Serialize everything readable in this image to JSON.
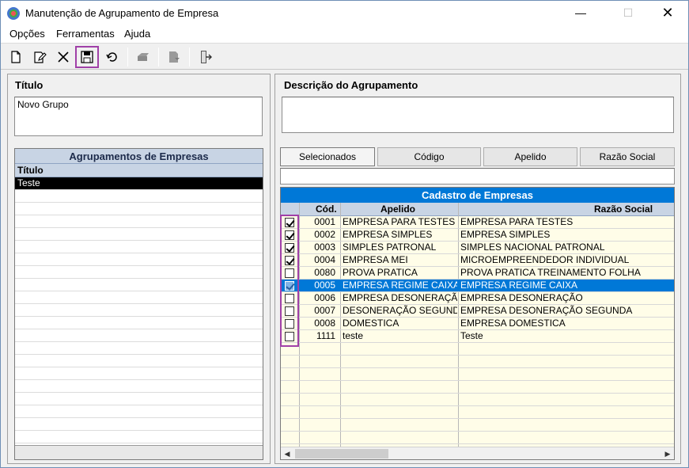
{
  "window": {
    "title": "Manutenção de Agrupamento de Empresa",
    "min": "—",
    "max": "☐",
    "close": "✕"
  },
  "menu": [
    "Opções",
    "Ferramentas",
    "Ajuda"
  ],
  "toolbar": {
    "buttons": [
      "new-document-icon",
      "edit-icon",
      "delete-icon",
      "save-icon",
      "undo-icon",
      "print-icon",
      "export-icon",
      "exit-icon"
    ],
    "highlight_color": "#a040a8"
  },
  "left": {
    "titulo_label": "Título",
    "titulo_value": "Novo Grupo",
    "grid_caption": "Agrupamentos de Empresas",
    "grid_header": "Título",
    "rows": [
      "Teste"
    ]
  },
  "right": {
    "descricao_label": "Descrição do Agrupamento",
    "descricao_value": "",
    "sort_buttons": [
      "Selecionados",
      "Código",
      "Apelido",
      "Razão Social"
    ],
    "search_value": "",
    "grid_caption": "Cadastro de Empresas",
    "columns": [
      "Cód.",
      "Apelido",
      "Razão Social"
    ],
    "rows": [
      {
        "checked": true,
        "cod": "0001",
        "apelido": "EMPRESA PARA TESTES",
        "razao": "EMPRESA PARA TESTES"
      },
      {
        "checked": true,
        "cod": "0002",
        "apelido": "EMPRESA SIMPLES",
        "razao": "EMPRESA SIMPLES"
      },
      {
        "checked": true,
        "cod": "0003",
        "apelido": "SIMPLES PATRONAL",
        "razao": "SIMPLES NACIONAL PATRONAL"
      },
      {
        "checked": true,
        "cod": "0004",
        "apelido": "EMPRESA MEI",
        "razao": "MICROEMPREENDEDOR INDIVIDUAL"
      },
      {
        "checked": false,
        "cod": "0080",
        "apelido": "PROVA PRATICA",
        "razao": "PROVA PRATICA TREINAMENTO FOLHA"
      },
      {
        "checked": true,
        "cod": "0005",
        "apelido": "EMPRESA REGIME CAIXA",
        "razao": "EMPRESA REGIME CAIXA",
        "selected": true
      },
      {
        "checked": false,
        "cod": "0006",
        "apelido": "EMPRESA DESONERAÇÃO",
        "razao": "EMPRESA DESONERAÇÃO"
      },
      {
        "checked": false,
        "cod": "0007",
        "apelido": "DESONERAÇÃO SEGUND.",
        "razao": "EMPRESA DESONERAÇÃO SEGUNDA"
      },
      {
        "checked": false,
        "cod": "0008",
        "apelido": "DOMESTICA",
        "razao": "EMPRESA DOMESTICA"
      },
      {
        "checked": false,
        "cod": "1111",
        "apelido": "teste",
        "razao": "Teste"
      }
    ],
    "selected_row_color": "#0078d7",
    "grid_bg_color": "#fffde8"
  }
}
